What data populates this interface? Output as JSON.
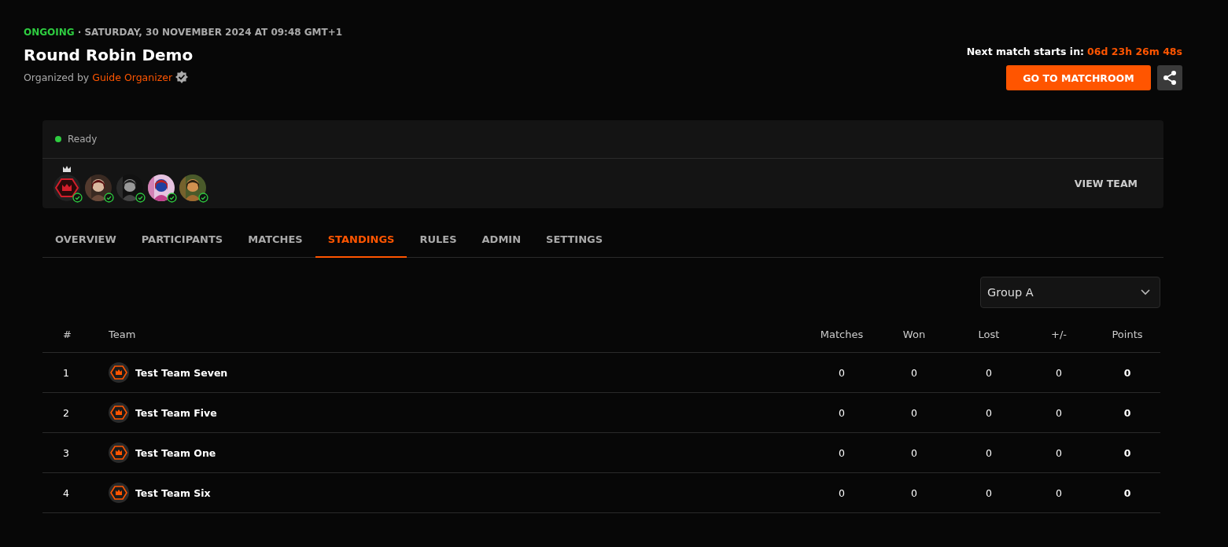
{
  "header": {
    "status": "ONGOING",
    "date": "· SATURDAY, 30 NOVEMBER 2024 AT 09:48 GMT+1",
    "title": "Round Robin Demo",
    "organized_by": "Organized by",
    "organizer": "Guide Organizer",
    "next_match_label": "Next match starts in:",
    "countdown": "06d 23h 26m 48s",
    "matchroom_button": "GO TO MATCHROOM"
  },
  "team_card": {
    "status": {
      "label": "Ready",
      "color": "#2ecc40"
    },
    "view_team": "VIEW TEAM",
    "members": [
      {
        "kind": "logo",
        "captain": true,
        "ready": true
      },
      {
        "kind": "picture",
        "captain": false,
        "ready": true
      },
      {
        "kind": "picture",
        "captain": false,
        "ready": true
      },
      {
        "kind": "picture",
        "captain": false,
        "ready": true
      },
      {
        "kind": "picture",
        "captain": false,
        "ready": true
      }
    ]
  },
  "tabs": [
    {
      "label": "OVERVIEW",
      "selected": false
    },
    {
      "label": "PARTICIPANTS",
      "selected": false
    },
    {
      "label": "MATCHES",
      "selected": false
    },
    {
      "label": "STANDINGS",
      "selected": true
    },
    {
      "label": "RULES",
      "selected": false
    },
    {
      "label": "ADMIN",
      "selected": false
    },
    {
      "label": "SETTINGS",
      "selected": false
    }
  ],
  "group_select": {
    "value": "Group A"
  },
  "table": {
    "columns": [
      "#",
      "Team",
      "Matches",
      "Won",
      "Lost",
      "+/-",
      "Points"
    ],
    "rows": [
      {
        "rank": "1",
        "team": "Test Team Seven",
        "matches": "0",
        "won": "0",
        "lost": "0",
        "diff": "0",
        "points": "0"
      },
      {
        "rank": "2",
        "team": "Test Team Five",
        "matches": "0",
        "won": "0",
        "lost": "0",
        "diff": "0",
        "points": "0"
      },
      {
        "rank": "3",
        "team": "Test Team One",
        "matches": "0",
        "won": "0",
        "lost": "0",
        "diff": "0",
        "points": "0"
      },
      {
        "rank": "4",
        "team": "Test Team Six",
        "matches": "0",
        "won": "0",
        "lost": "0",
        "diff": "0",
        "points": "0"
      }
    ]
  }
}
